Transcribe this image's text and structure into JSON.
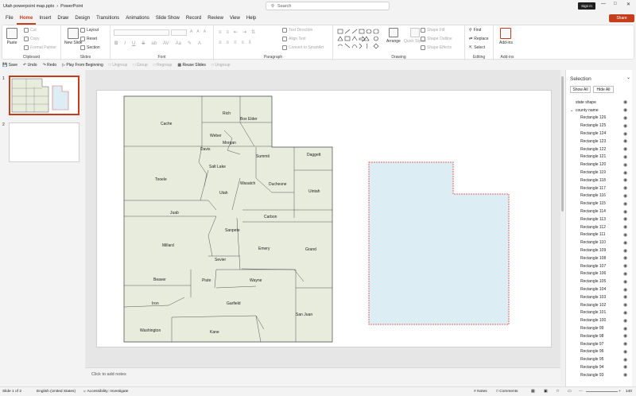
{
  "titlebar": {
    "document": "Utah powerpoint map.pptx",
    "app": "PowerPoint",
    "search_placeholder": "Search",
    "signin": "Sign in",
    "share": "Share"
  },
  "menu": [
    "File",
    "Home",
    "Insert",
    "Draw",
    "Design",
    "Transitions",
    "Animations",
    "Slide Show",
    "Record",
    "Review",
    "View",
    "Help"
  ],
  "ribbon": {
    "clipboard": {
      "label": "Clipboard",
      "paste": "Paste",
      "cut": "Cut",
      "copy": "Copy",
      "format_painter": "Format Painter"
    },
    "slides": {
      "label": "Slides",
      "new_slide": "New Slide",
      "layout": "Layout",
      "reset": "Reset",
      "section": "Section"
    },
    "font": {
      "label": "Font"
    },
    "paragraph": {
      "label": "Paragraph",
      "text_direction": "Text Direction",
      "align_text": "Align Text",
      "convert": "Convert to SmartArt"
    },
    "drawing": {
      "label": "Drawing",
      "arrange": "Arrange",
      "quick_styles": "Quick Styles",
      "shape_fill": "Shape Fill",
      "shape_outline": "Shape Outline",
      "shape_effects": "Shape Effects"
    },
    "editing": {
      "label": "Editing",
      "find": "Find",
      "replace": "Replace",
      "select": "Select"
    },
    "addins": {
      "label": "Add-ins",
      "addins": "Add-ins"
    }
  },
  "qat": [
    "Save",
    "Undo",
    "Redo",
    "Play From Beginning",
    "Ungroup",
    "Group",
    "Regroup",
    "Reuse Slides",
    "Ungroup"
  ],
  "thumbs": {
    "slide1": "1",
    "slide2": "2"
  },
  "counties": [
    "Cache",
    "Rich",
    "Box Elder",
    "Weber",
    "Morgan",
    "Davis",
    "Daggett",
    "Summit",
    "Salt Lake",
    "Tooele",
    "Duchesne",
    "Wasatch",
    "Uintah",
    "Utah",
    "Juab",
    "Carbon",
    "Sanpete",
    "Millard",
    "Emery",
    "Grand",
    "Sevier",
    "Beaver",
    "Piute",
    "Wayne",
    "Iron",
    "Garfield",
    "San Juan",
    "Washington",
    "Kane"
  ],
  "notes": "Click to add notes",
  "selection": {
    "title": "Selection",
    "show_all": "Show All",
    "hide_all": "Hide All",
    "items": [
      "state shape",
      "county name",
      "Rectangle 126",
      "Rectangle 125",
      "Rectangle 124",
      "Rectangle 123",
      "Rectangle 122",
      "Rectangle 121",
      "Rectangle 120",
      "Rectangle 119",
      "Rectangle 118",
      "Rectangle 117",
      "Rectangle 116",
      "Rectangle 115",
      "Rectangle 114",
      "Rectangle 113",
      "Rectangle 112",
      "Rectangle 111",
      "Rectangle 110",
      "Rectangle 109",
      "Rectangle 108",
      "Rectangle 107",
      "Rectangle 106",
      "Rectangle 105",
      "Rectangle 104",
      "Rectangle 103",
      "Rectangle 102",
      "Rectangle 101",
      "Rectangle 100",
      "Rectangle 99",
      "Rectangle 98",
      "Rectangle 97",
      "Rectangle 96",
      "Rectangle 95",
      "Rectangle 94",
      "Rectangle 93"
    ]
  },
  "status": {
    "slide": "Slide 1 of 2",
    "language": "English (United States)",
    "accessibility": "Accessibility: Investigate",
    "notes": "Notes",
    "comments": "Comments",
    "zoom": "140"
  },
  "colors": {
    "accent": "#c43e1c",
    "map_fill": "#e8ecdc",
    "shape_fill": "#dcedf3",
    "shape_outline": "#e06666"
  }
}
